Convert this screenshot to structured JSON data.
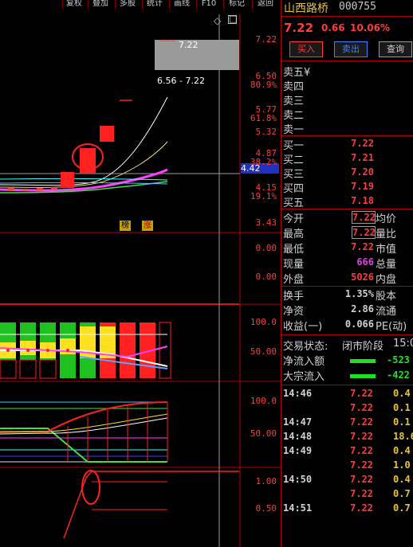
{
  "toolbar": {
    "buttons": [
      "复权",
      "叠加",
      "多股",
      "统计",
      "画线",
      "F10",
      "标记",
      "返回"
    ]
  },
  "stock": {
    "name": "山西路桥",
    "code": "000755",
    "price": "7.22",
    "change": "0.66",
    "change_pct": "10.06%"
  },
  "actions": {
    "buy": "买入",
    "sell": "卖出",
    "query": "查询"
  },
  "sell_book": [
    {
      "label": "卖五",
      "price": "",
      "suffix": "¥"
    },
    {
      "label": "卖四",
      "price": ""
    },
    {
      "label": "卖三",
      "price": ""
    },
    {
      "label": "卖二",
      "price": ""
    },
    {
      "label": "卖一",
      "price": ""
    }
  ],
  "buy_book": [
    {
      "label": "买一",
      "price": "7.22"
    },
    {
      "label": "买二",
      "price": "7.21"
    },
    {
      "label": "买三",
      "price": "7.20"
    },
    {
      "label": "买四",
      "price": "7.19"
    },
    {
      "label": "买五",
      "price": "7.18"
    }
  ],
  "quote": {
    "open_label": "今开",
    "open": "7.22",
    "avg_label": "均价",
    "high_label": "最高",
    "high": "7.22",
    "ratio_label": "量比",
    "low_label": "最低",
    "low": "7.22",
    "mcap_label": "市值",
    "cur_label": "现量",
    "cur": "666",
    "total_label": "总量",
    "out_label": "外盘",
    "out": "5026",
    "in_label": "内盘",
    "turnover_label": "换手",
    "turnover": "1.35%",
    "equity_label": "股本",
    "nav_label": "净资",
    "nav": "2.86",
    "float_label": "流通",
    "eps_label": "收益(一)",
    "eps": "0.066",
    "pe_label": "PE(动)"
  },
  "status": {
    "label": "交易状态:",
    "value": "闭市阶段",
    "time": "15:0",
    "net_inflow_label": "净流入额",
    "net_inflow": "-523",
    "block_inflow_label": "大宗流入",
    "block_inflow": "-422"
  },
  "ticks": [
    {
      "time": "14:46",
      "price": "7.22",
      "vol": "0.4"
    },
    {
      "time": "",
      "price": "7.22",
      "vol": "0.1"
    },
    {
      "time": "14:47",
      "price": "7.22",
      "vol": "0.1"
    },
    {
      "time": "14:48",
      "price": "7.22",
      "vol": "18.6"
    },
    {
      "time": "14:49",
      "price": "7.22",
      "vol": "0.4"
    },
    {
      "time": "",
      "price": "7.22",
      "vol": "1.0"
    },
    {
      "time": "14:50",
      "price": "7.22",
      "vol": "0.4"
    },
    {
      "time": "",
      "price": "7.22",
      "vol": "0.7"
    },
    {
      "time": "14:51",
      "price": "7.22",
      "vol": "0.7"
    }
  ],
  "main_chart": {
    "tooltip": "6.56 - 7.22",
    "top_marker": "7.22",
    "crosshair_value": "4.42",
    "tags": [
      "榜",
      "涨"
    ],
    "axis": [
      "7.22",
      "6.50",
      "80.9%",
      "5.77",
      "61.8%",
      "5.32",
      "4.87",
      "38.2%",
      "4.15",
      "19.1%",
      "3.43"
    ]
  },
  "panel2_axis": [
    "0.00",
    "0.00"
  ],
  "panel3_axis": [
    "100.0",
    "50.00"
  ],
  "panel4_axis": [
    "100.0",
    "50.00"
  ],
  "panel5_axis": [
    "1.00",
    "0.50"
  ],
  "colors": {
    "up": "#ff3b3b",
    "accent": "#e8c33a",
    "border": "#b00000",
    "text": "#d0d0d0"
  }
}
